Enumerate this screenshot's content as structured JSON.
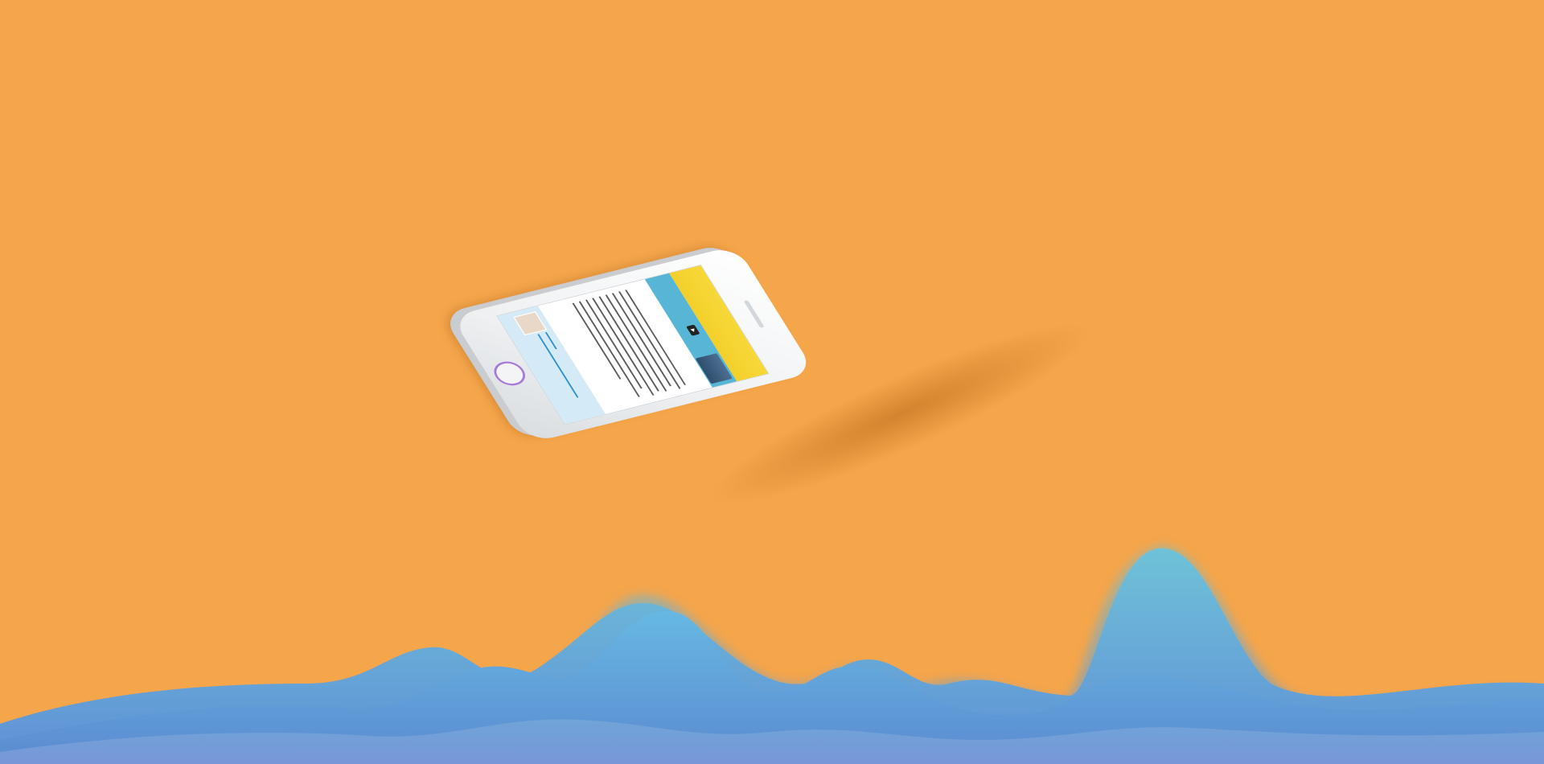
{
  "scene": {
    "background_color": "#f5a54a",
    "wave_colors": [
      "#7ea6d4",
      "#6fbed9",
      "#5ea3da",
      "#8ab2e0"
    ],
    "phone_colors": {
      "body": "#f2f3f5",
      "home_ring": "#a77ad8"
    }
  }
}
